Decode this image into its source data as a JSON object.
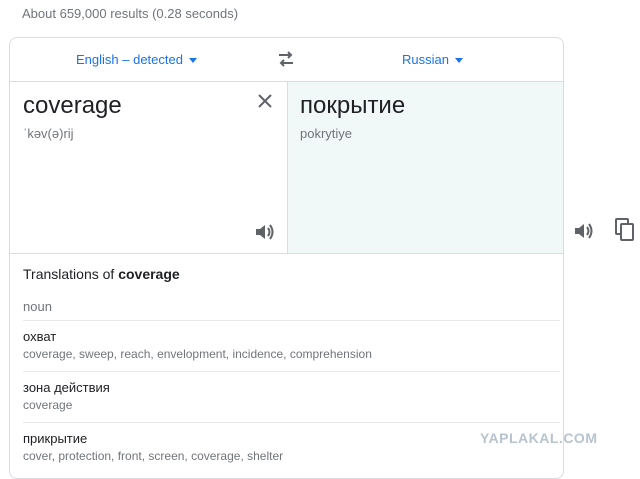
{
  "search_stats": "About 659,000 results (0.28 seconds)",
  "translator": {
    "source_lang": "English – detected",
    "target_lang": "Russian",
    "source_text": "coverage",
    "phonetic": "ˈkəv(ə)rij",
    "translated_text": "покрытие",
    "transliteration": "pokrytiye",
    "accent_color": "#1a73e8"
  },
  "dictionary": {
    "title_prefix": "Translations of ",
    "title_word": "coverage",
    "part_of_speech": "noun",
    "entries": [
      {
        "term": "охват",
        "synonyms": "coverage, sweep, reach, envelopment, incidence, comprehension"
      },
      {
        "term": "зона действия",
        "synonyms": "coverage"
      },
      {
        "term": "прикрытие",
        "synonyms": "cover, protection, front, screen, coverage, shelter"
      }
    ]
  },
  "watermark": "YAPLAKAL.COM",
  "icons": {
    "swap": "swap-arrows-icon",
    "clear": "close-icon",
    "speaker": "speaker-icon",
    "copy": "copy-icon"
  }
}
